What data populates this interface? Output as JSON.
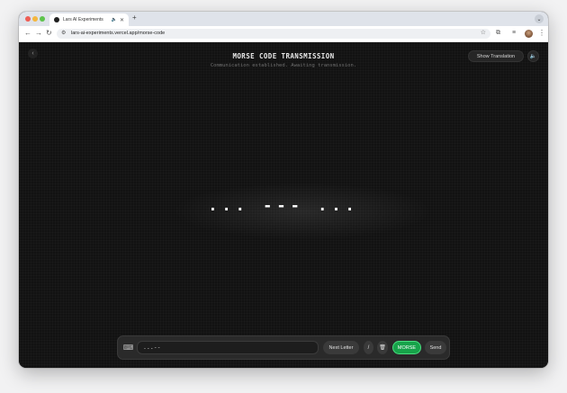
{
  "browser": {
    "tab_title": "Lars AI Experiments",
    "new_tab_glyph": "+",
    "close_glyph": "✕",
    "audio_glyph": "🔈",
    "dropdown_glyph": "⌄",
    "back_glyph": "←",
    "forward_glyph": "→",
    "reload_glyph": "↻",
    "url": "lars-ai-experiments.vercel.app/morse-code",
    "site_info_glyph": "⚙",
    "star_glyph": "☆",
    "extensions_glyph": "⧉",
    "media_glyph": "≡",
    "menu_glyph": "⋮"
  },
  "page": {
    "back_glyph": "‹",
    "title": "MORSE CODE TRANSMISSION",
    "subtitle": "Communication established. Awaiting transmission.",
    "show_translation_label": "Show Translation",
    "sound_glyph": "🔈",
    "morse_display": "... --- ..."
  },
  "input_bar": {
    "keyboard_glyph": "⌨",
    "input_value": "...--",
    "next_letter_label": "Next Letter",
    "slash_label": "/",
    "trash_glyph": "🗑",
    "mode_label": "MORSE",
    "send_label": "Send"
  },
  "colors": {
    "page_background": "#121212",
    "accent_green": "#17a34a"
  }
}
